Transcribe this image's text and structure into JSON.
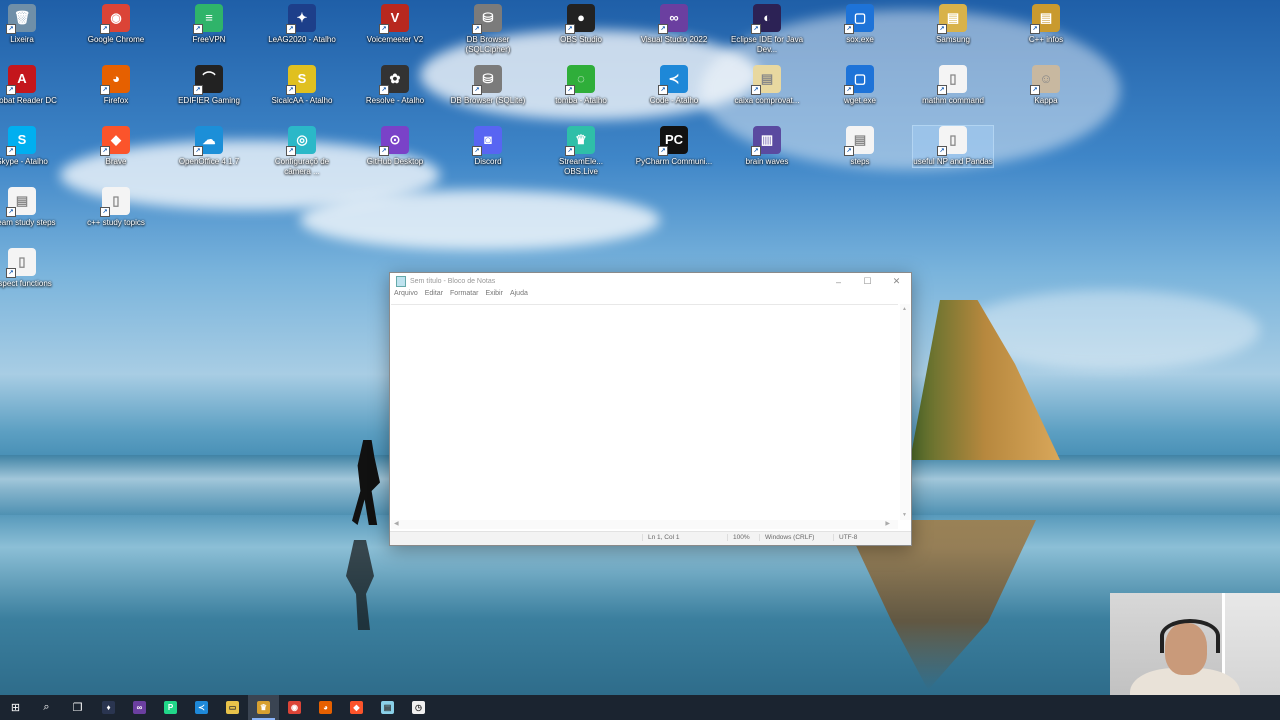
{
  "desktop": {
    "icons": [
      {
        "label": "Lixeira",
        "glyph": "🗑",
        "color": "#6f8fa8"
      },
      {
        "label": "Google Chrome",
        "glyph": "◉",
        "color": "#db4437"
      },
      {
        "label": "FreeVPN",
        "glyph": "≡",
        "color": "#2fb46a"
      },
      {
        "label": "LeAG2020 - Atalho",
        "glyph": "✦",
        "color": "#1d3f8a"
      },
      {
        "label": "Voicemeeter V2",
        "glyph": "V",
        "color": "#b8281f"
      },
      {
        "label": "DB Browser (SQLCipher)",
        "glyph": "⛁",
        "color": "#7b7b7b"
      },
      {
        "label": "OBS Studio",
        "glyph": "●",
        "color": "#222222"
      },
      {
        "label": "Visual Studio 2022",
        "glyph": "∞",
        "color": "#6b3fa0"
      },
      {
        "label": "Eclipse IDE for Java Dev...",
        "glyph": "◐",
        "color": "#2c2255"
      },
      {
        "label": "sox.exe",
        "glyph": "▢",
        "color": "#1e73d8"
      },
      {
        "label": "Samsung",
        "glyph": "▤",
        "color": "#d8b24a"
      },
      {
        "label": "C++ infos",
        "glyph": "▤",
        "color": "#c99a2e"
      },
      {
        "label": "Acrobat Reader DC",
        "glyph": "A",
        "color": "#c4161c"
      },
      {
        "label": "Firefox",
        "glyph": "◕",
        "color": "#e66000"
      },
      {
        "label": "EDIFIER Gaming",
        "glyph": "⌒",
        "color": "#222222"
      },
      {
        "label": "SicalcAA - Atalho",
        "glyph": "S",
        "color": "#e0c020"
      },
      {
        "label": "Resolve - Atalho",
        "glyph": "✿",
        "color": "#333333"
      },
      {
        "label": "DB Browser (SQLite)",
        "glyph": "⛁",
        "color": "#7b7b7b"
      },
      {
        "label": "tomba - Atalho",
        "glyph": "◌",
        "color": "#2fae3a"
      },
      {
        "label": "Code - Atalho",
        "glyph": "≺",
        "color": "#1e88d8"
      },
      {
        "label": "caixa comprovat...",
        "glyph": "▤",
        "color": "#e8d8a0"
      },
      {
        "label": "wget.exe",
        "glyph": "▢",
        "color": "#1e73d8"
      },
      {
        "label": "mathm command",
        "glyph": "▯",
        "color": "#f4f4f4"
      },
      {
        "label": "Kappa",
        "glyph": "☺",
        "color": "#c8b8a0"
      },
      {
        "label": "Skype - Atalho",
        "glyph": "S",
        "color": "#00aff0"
      },
      {
        "label": "Brave",
        "glyph": "◆",
        "color": "#fb542b"
      },
      {
        "label": "OpenOffice 4.1.7",
        "glyph": "☁",
        "color": "#1c8fd8"
      },
      {
        "label": "Configuraçõ de câmera ...",
        "glyph": "◎",
        "color": "#2bb8c8"
      },
      {
        "label": "GitHub Desktop",
        "glyph": "⊙",
        "color": "#7a42c8"
      },
      {
        "label": "Discord",
        "glyph": "◙",
        "color": "#5865f2"
      },
      {
        "label": "StreamEle... OBS.Live",
        "glyph": "♛",
        "color": "#2fbfa8"
      },
      {
        "label": "PyCharm Communi...",
        "glyph": "PC",
        "color": "#111111"
      },
      {
        "label": "brain waves",
        "glyph": "▥",
        "color": "#5a4aa0"
      },
      {
        "label": "steps",
        "glyph": "▤",
        "color": "#f4f4f4"
      },
      {
        "label": "useful NP and Pandas",
        "glyph": "▯",
        "color": "#f4f4f4"
      },
      {
        "label": "stream study steps",
        "glyph": "▤",
        "color": "#f4f4f4"
      },
      {
        "label": "c++ study topics",
        "glyph": "▯",
        "color": "#f4f4f4"
      },
      {
        "label": "inspect functions",
        "glyph": "▯",
        "color": "#f4f4f4"
      }
    ]
  },
  "notepad": {
    "title": "Sem título - Bloco de Notas",
    "minimize": "–",
    "maximize": "☐",
    "close": "✕",
    "menu": [
      "Arquivo",
      "Editar",
      "Formatar",
      "Exibir",
      "Ajuda"
    ],
    "content": "",
    "status": {
      "position": "Ln 1, Col 1",
      "zoom": "100%",
      "line_ending": "Windows (CRLF)",
      "encoding": "UTF-8"
    }
  },
  "taskbar": {
    "items": [
      {
        "name": "start-button",
        "glyph": "⊞",
        "color": "#ffffff"
      },
      {
        "name": "search-icon",
        "glyph": "⌕",
        "color": "#ffffff"
      },
      {
        "name": "task-view-icon",
        "glyph": "❐",
        "color": "#ffffff"
      },
      {
        "name": "resolve-taskbar-icon",
        "glyph": "♦",
        "color": "#2a3550"
      },
      {
        "name": "visual-studio-taskbar-icon",
        "glyph": "∞",
        "color": "#6b3fa0"
      },
      {
        "name": "pycharm-taskbar-icon",
        "glyph": "P",
        "color": "#21d789"
      },
      {
        "name": "vscode-taskbar-icon",
        "glyph": "≺",
        "color": "#1e88d8"
      },
      {
        "name": "file-explorer-taskbar-icon",
        "glyph": "▭",
        "color": "#e8c24a"
      },
      {
        "name": "streamelements-taskbar-icon",
        "glyph": "♛",
        "color": "#d8a030"
      },
      {
        "name": "chrome-taskbar-icon",
        "glyph": "◉",
        "color": "#db4437"
      },
      {
        "name": "firefox-taskbar-icon",
        "glyph": "◕",
        "color": "#e66000"
      },
      {
        "name": "brave-taskbar-icon",
        "glyph": "◆",
        "color": "#fb542b"
      },
      {
        "name": "notepad-taskbar-icon",
        "glyph": "▤",
        "color": "#8ad0e8"
      },
      {
        "name": "clock-app-taskbar-icon",
        "glyph": "◷",
        "color": "#f0f0f0"
      }
    ]
  }
}
